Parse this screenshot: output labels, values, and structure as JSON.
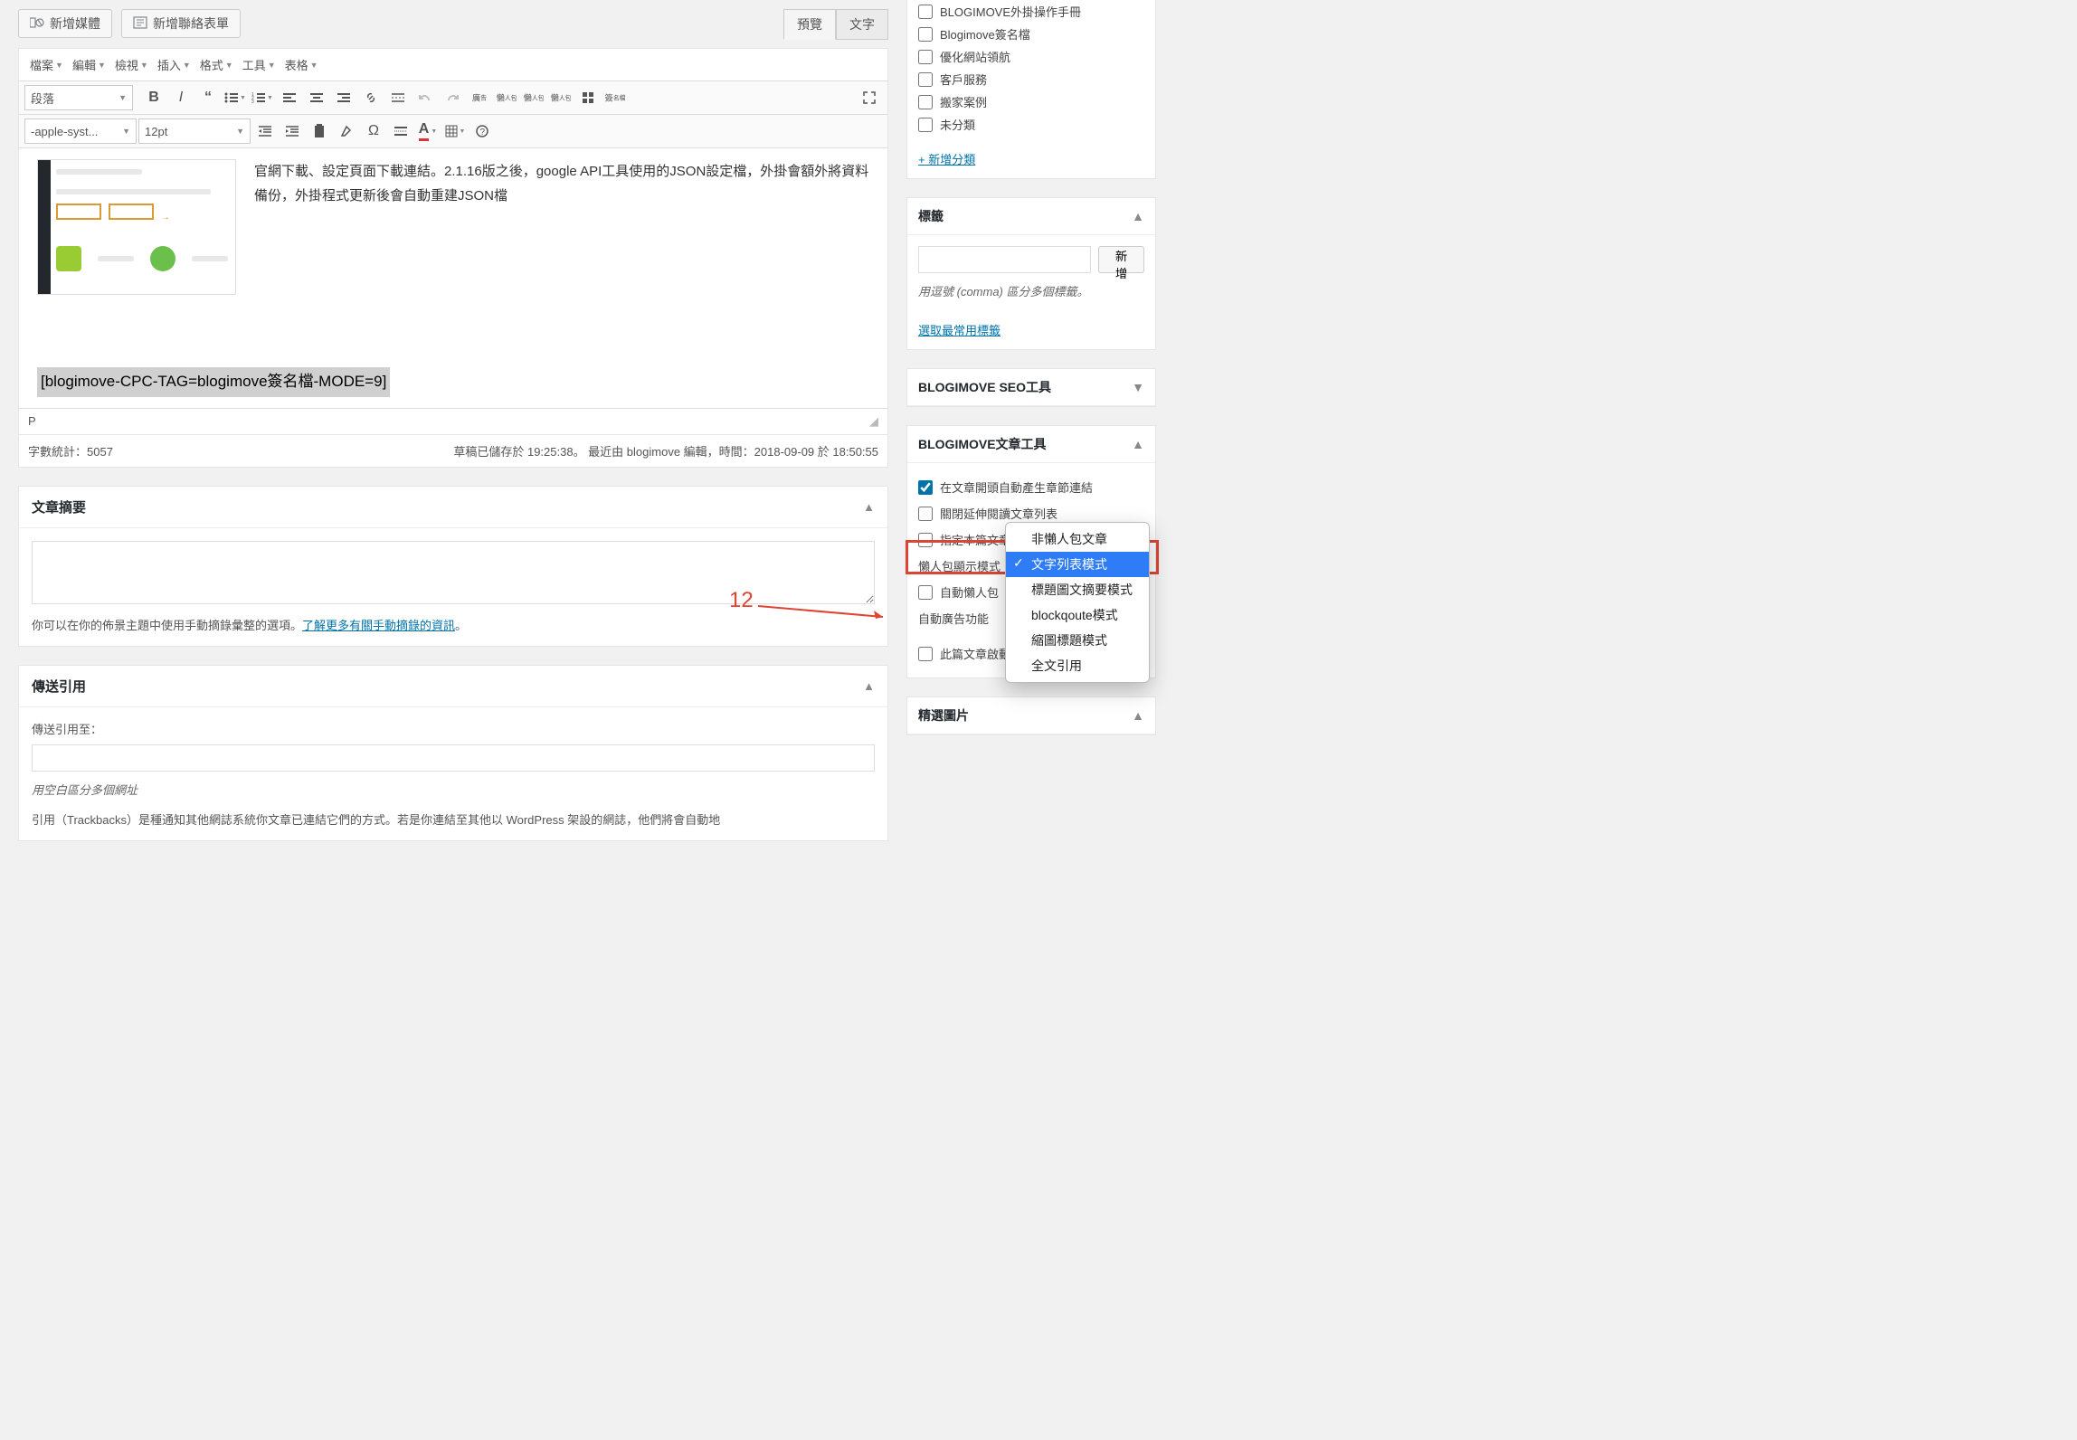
{
  "buttons": {
    "add_media": "新增媒體",
    "add_contact_form": "新增聯絡表單"
  },
  "tabs": {
    "visual": "預覽",
    "text": "文字"
  },
  "menus": [
    "檔案",
    "編輯",
    "檢視",
    "插入",
    "格式",
    "工具",
    "表格"
  ],
  "format_select": "段落",
  "font_select": "-apple-syst...",
  "fontsize_select": "12pt",
  "editor_text": "官網下載、設定頁面下載連結。2.1.16版之後，google API工具使用的JSON設定檔，外掛會額外將資料備份，外掛程式更新後會自動重建JSON檔",
  "shortcode": "[blogimove-CPC-TAG=blogimove簽名檔-MODE=9]",
  "status_path": "P",
  "word_count_label": "字數統計：",
  "word_count_value": "5057",
  "save_status": "草稿已儲存於 19:25:38。 最近由 blogimove 編輯，時間：2018-09-09 於 18:50:55",
  "excerpt": {
    "title": "文章摘要",
    "hint_prefix": "你可以在你的佈景主題中使用手動摘錄彙整的選項。",
    "hint_link": "了解更多有關手動摘錄的資訊",
    "hint_suffix": "。"
  },
  "trackback": {
    "title": "傳送引用",
    "label": "傳送引用至：",
    "hint1": "用空白區分多個網址",
    "hint2_prefix": "引用（Trackbacks）是種通知其他網誌系統你文章已連結它們的方式。若是你連結至其他以 WordPress 架設的網誌，他們將會自動地"
  },
  "categories": [
    "BLOGIMOVE外掛操作手冊",
    "Blogimove簽名檔",
    "優化網站領航",
    "客戶服務",
    "搬家案例",
    "未分類"
  ],
  "add_category": "+ 新增分類",
  "tags": {
    "title": "標籤",
    "add_btn": "新增",
    "hint": "用逗號 (comma) 區分多個標籤。",
    "popular": "選取最常用標籤"
  },
  "seo_box": "BLOGIMOVE SEO工具",
  "article_box": {
    "title": "BLOGIMOVE文章工具",
    "opt1": "在文章開頭自動產生章節連結",
    "opt2": "關閉延伸閱讀文章列表",
    "opt3": "指定本篇文章為文章範本",
    "mode_label": "懶人包顯示模式",
    "auto_label": "自動懶人包",
    "ad_label": "自動廣告功能",
    "opt4": "此篇文章啟動NL2BR功能"
  },
  "dropdown_options": [
    "非懶人包文章",
    "文字列表模式",
    "標題圖文摘要模式",
    "blockqoute模式",
    "縮圖標題模式",
    "全文引用"
  ],
  "featured_image": "精選圖片",
  "annotation_num": "12"
}
